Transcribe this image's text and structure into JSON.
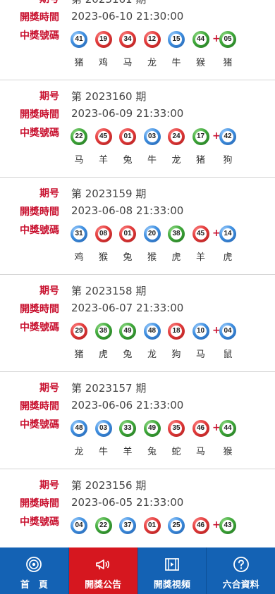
{
  "labels": {
    "period": "期号",
    "time": "開獎時間",
    "numbers": "中獎號碼"
  },
  "records": [
    {
      "period": "第 2023161 期",
      "time": "2023-06-10 21:30:00",
      "balls": [
        {
          "n": "41",
          "c": "blue"
        },
        {
          "n": "19",
          "c": "red"
        },
        {
          "n": "34",
          "c": "red"
        },
        {
          "n": "12",
          "c": "red"
        },
        {
          "n": "15",
          "c": "blue"
        },
        {
          "n": "44",
          "c": "green"
        }
      ],
      "special": {
        "n": "05",
        "c": "green"
      },
      "zodiacs": [
        "猪",
        "鸡",
        "马",
        "龙",
        "牛",
        "猴",
        "猪"
      ]
    },
    {
      "period": "第 2023160 期",
      "time": "2023-06-09 21:33:00",
      "balls": [
        {
          "n": "22",
          "c": "green"
        },
        {
          "n": "45",
          "c": "red"
        },
        {
          "n": "01",
          "c": "red"
        },
        {
          "n": "03",
          "c": "blue"
        },
        {
          "n": "24",
          "c": "red"
        },
        {
          "n": "17",
          "c": "green"
        }
      ],
      "special": {
        "n": "42",
        "c": "blue"
      },
      "zodiacs": [
        "马",
        "羊",
        "兔",
        "牛",
        "龙",
        "猪",
        "狗"
      ]
    },
    {
      "period": "第 2023159 期",
      "time": "2023-06-08 21:33:00",
      "balls": [
        {
          "n": "31",
          "c": "blue"
        },
        {
          "n": "08",
          "c": "red"
        },
        {
          "n": "01",
          "c": "red"
        },
        {
          "n": "20",
          "c": "blue"
        },
        {
          "n": "38",
          "c": "green"
        },
        {
          "n": "45",
          "c": "red"
        }
      ],
      "special": {
        "n": "14",
        "c": "blue"
      },
      "zodiacs": [
        "鸡",
        "猴",
        "兔",
        "猴",
        "虎",
        "羊",
        "虎"
      ]
    },
    {
      "period": "第 2023158 期",
      "time": "2023-06-07 21:33:00",
      "balls": [
        {
          "n": "29",
          "c": "red"
        },
        {
          "n": "38",
          "c": "green"
        },
        {
          "n": "49",
          "c": "green"
        },
        {
          "n": "48",
          "c": "blue"
        },
        {
          "n": "18",
          "c": "red"
        },
        {
          "n": "10",
          "c": "blue"
        }
      ],
      "special": {
        "n": "04",
        "c": "blue"
      },
      "zodiacs": [
        "猪",
        "虎",
        "兔",
        "龙",
        "狗",
        "马",
        "鼠"
      ]
    },
    {
      "period": "第 2023157 期",
      "time": "2023-06-06 21:33:00",
      "balls": [
        {
          "n": "48",
          "c": "blue"
        },
        {
          "n": "03",
          "c": "blue"
        },
        {
          "n": "33",
          "c": "green"
        },
        {
          "n": "49",
          "c": "green"
        },
        {
          "n": "35",
          "c": "red"
        },
        {
          "n": "46",
          "c": "red"
        }
      ],
      "special": {
        "n": "44",
        "c": "green"
      },
      "zodiacs": [
        "龙",
        "牛",
        "羊",
        "兔",
        "蛇",
        "马",
        "猴"
      ]
    },
    {
      "period": "第 2023156 期",
      "time": "2023-06-05 21:33:00",
      "balls": [
        {
          "n": "04",
          "c": "blue"
        },
        {
          "n": "22",
          "c": "green"
        },
        {
          "n": "37",
          "c": "blue"
        },
        {
          "n": "01",
          "c": "red"
        },
        {
          "n": "25",
          "c": "blue"
        },
        {
          "n": "46",
          "c": "red"
        }
      ],
      "special": {
        "n": "43",
        "c": "green"
      },
      "zodiacs": []
    }
  ],
  "nav": [
    {
      "label": "首　頁",
      "icon": "target-icon",
      "active": false
    },
    {
      "label": "開獎公告",
      "icon": "megaphone-icon",
      "active": true
    },
    {
      "label": "開獎視頻",
      "icon": "video-icon",
      "active": false
    },
    {
      "label": "六合資料",
      "icon": "help-circle-icon",
      "active": false
    }
  ],
  "colors": {
    "accent_red": "#c8102e",
    "nav_blue": "#1462b4",
    "nav_active": "#d6171f"
  }
}
